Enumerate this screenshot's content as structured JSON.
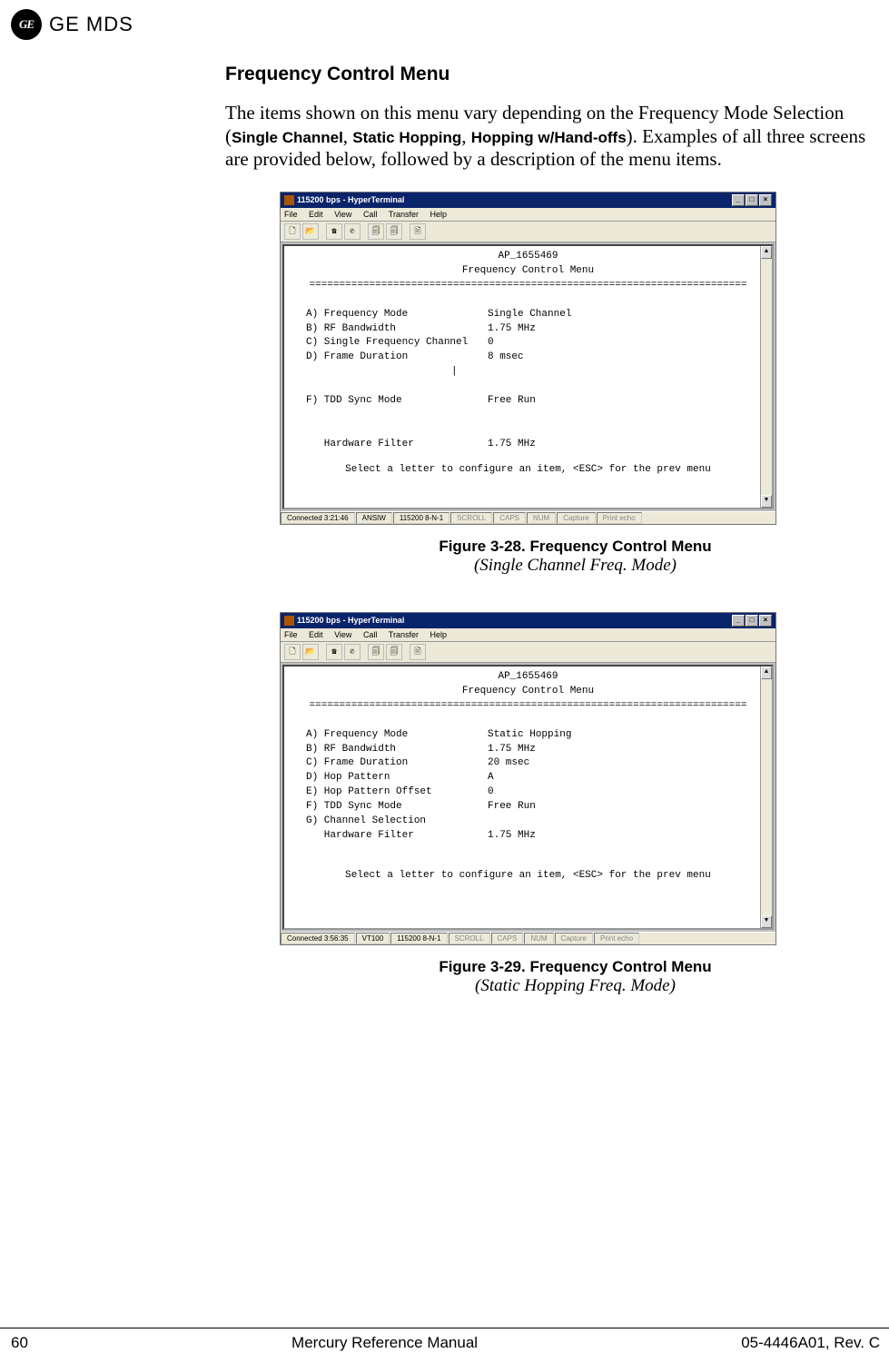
{
  "header": {
    "logo_monogram": "GE",
    "logo_text": "GE MDS"
  },
  "section": {
    "title": "Frequency Control Menu",
    "body_pre": "The items shown on this menu vary depending on the Frequency Mode Selection (",
    "opt1": "Single Channel",
    "sep1": ", ",
    "opt2": "Static Hopping",
    "sep2": ", ",
    "opt3": "Hopping w/Hand-offs",
    "body_post": "). Examples of all three screens are provided below, followed by a description of the menu items."
  },
  "window": {
    "title": "115200 bps - HyperTerminal",
    "menubar": {
      "file": "File",
      "edit": "Edit",
      "view": "View",
      "call": "Call",
      "transfer": "Transfer",
      "help": "Help"
    },
    "min": "_",
    "max": "□",
    "close": "×"
  },
  "term1": {
    "ap": "AP_1655469",
    "heading": "Frequency Control Menu",
    "rule": "=========================================================================",
    "rows": {
      "a_label": "A) Frequency Mode",
      "a_value": "Single Channel",
      "b_label": "B) RF Bandwidth",
      "b_value": "1.75 MHz",
      "c_label": "C) Single Frequency Channel",
      "c_value": "0",
      "d_label": "D) Frame Duration",
      "d_value": "8 msec",
      "f_label": "F) TDD Sync Mode",
      "f_value": "Free Run",
      "hw_label": "   Hardware Filter",
      "hw_value": "1.75 MHz"
    },
    "footer": "Select a letter to configure an item, <ESC> for the prev menu",
    "status": {
      "conn": "Connected 3:21:46",
      "emul": "ANSIW",
      "speed": "115200 8-N-1",
      "scroll": "SCROLL",
      "caps": "CAPS",
      "num": "NUM",
      "capture": "Capture",
      "print": "Print echo"
    }
  },
  "fig1": {
    "title": "Figure 3-28. Frequency Control Menu",
    "sub": "(Single Channel Freq. Mode)"
  },
  "term2": {
    "ap": "AP_1655469",
    "heading": "Frequency Control Menu",
    "rule": "=========================================================================",
    "rows": {
      "a_label": "A) Frequency Mode",
      "a_value": "Static Hopping",
      "b_label": "B) RF Bandwidth",
      "b_value": "1.75 MHz",
      "c_label": "C) Frame Duration",
      "c_value": "20 msec",
      "d_label": "D) Hop Pattern",
      "d_value": "A",
      "e_label": "E) Hop Pattern Offset",
      "e_value": "0",
      "f_label": "F) TDD Sync Mode",
      "f_value": "Free Run",
      "g_label": "G) Channel Selection",
      "g_value": "",
      "hw_label": "   Hardware Filter",
      "hw_value": "1.75 MHz"
    },
    "footer": "Select a letter to configure an item, <ESC> for the prev menu",
    "status": {
      "conn": "Connected 3:56:35",
      "emul": "VT100",
      "speed": "115200 8-N-1",
      "scroll": "SCROLL",
      "caps": "CAPS",
      "num": "NUM",
      "capture": "Capture",
      "print": "Print echo"
    }
  },
  "fig2": {
    "title": "Figure 3-29. Frequency Control Menu",
    "sub": "(Static Hopping Freq. Mode)"
  },
  "footer": {
    "page": "60",
    "title": "Mercury Reference Manual",
    "rev": "05-4446A01, Rev. C"
  }
}
